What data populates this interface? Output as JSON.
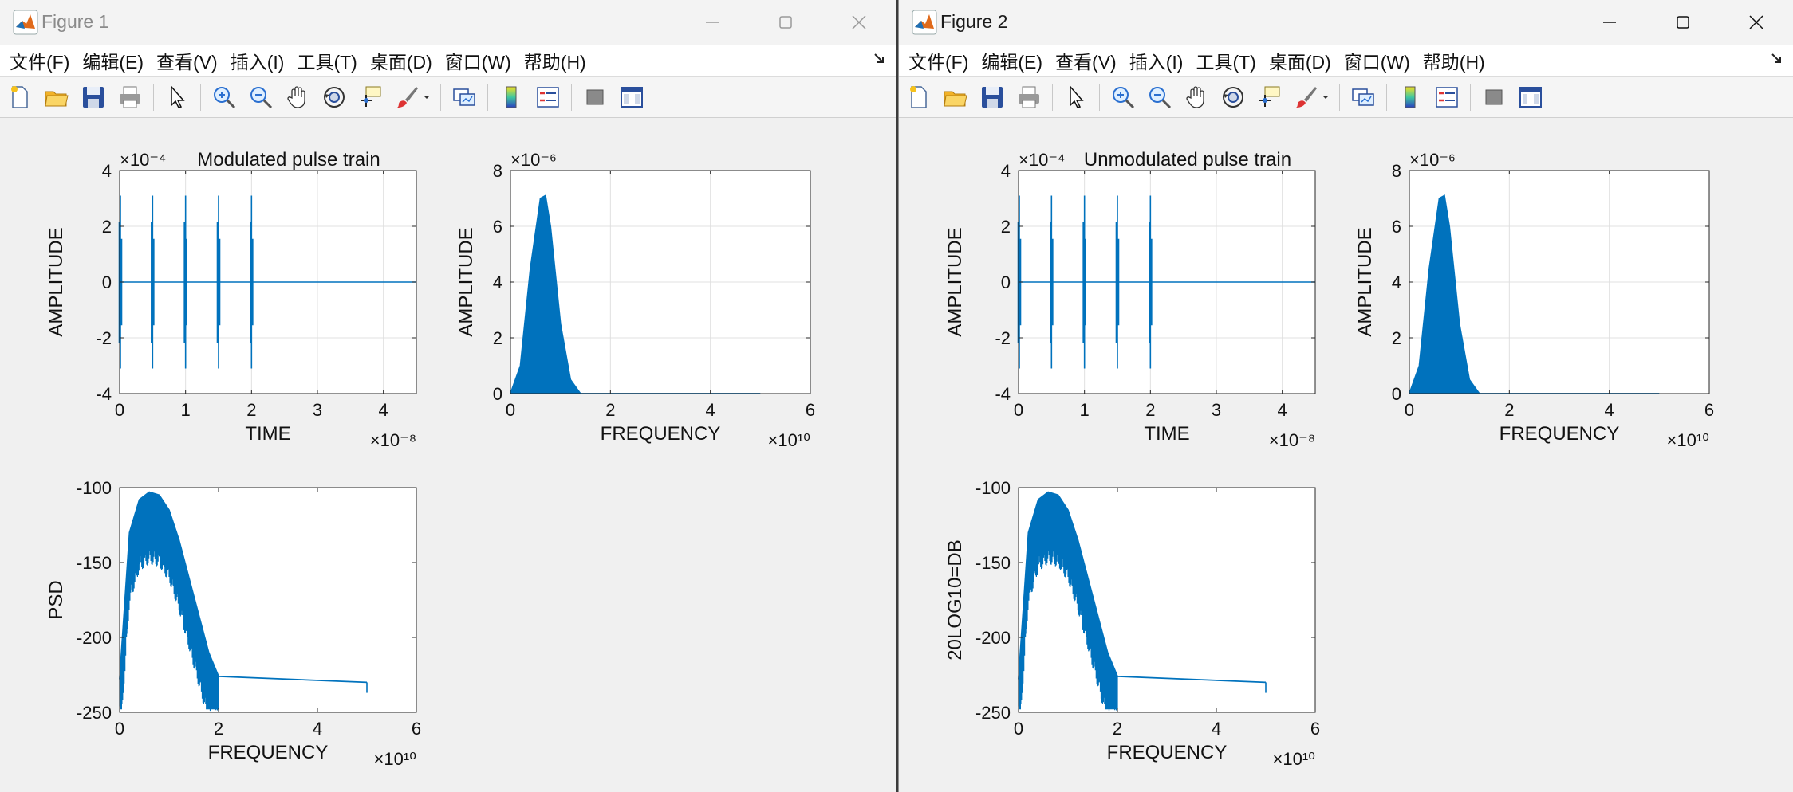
{
  "windows": [
    {
      "title": "Figure 1",
      "menus": [
        "文件(F)",
        "编辑(E)",
        "查看(V)",
        "插入(I)",
        "工具(T)",
        "桌面(D)",
        "窗口(W)",
        "帮助(H)"
      ],
      "plots": [
        {
          "title": "Modulated pulse train",
          "xlabel": "TIME",
          "ylabel": "AMPLITUDE",
          "xticks": [
            "0",
            "1",
            "2",
            "3",
            "4"
          ],
          "yticks": [
            "4",
            "2",
            "0",
            "-2",
            "-4"
          ],
          "yexp": "×10⁻⁴",
          "xexp": "×10⁻⁸"
        },
        {
          "title": "",
          "xlabel": "FREQUENCY",
          "ylabel": "AMPLITUDE",
          "xticks": [
            "0",
            "2",
            "4",
            "6"
          ],
          "yticks": [
            "8",
            "6",
            "4",
            "2",
            "0"
          ],
          "yexp": "×10⁻⁶",
          "xexp": "×10¹⁰"
        },
        {
          "title": "",
          "xlabel": "FREQUENCY",
          "ylabel": "PSD",
          "xticks": [
            "0",
            "2",
            "4",
            "6"
          ],
          "yticks": [
            "-100",
            "-150",
            "-200",
            "-250"
          ],
          "yexp": "",
          "xexp": "×10¹⁰"
        }
      ]
    },
    {
      "title": "Figure 2",
      "menus": [
        "文件(F)",
        "编辑(E)",
        "查看(V)",
        "插入(I)",
        "工具(T)",
        "桌面(D)",
        "窗口(W)",
        "帮助(H)"
      ],
      "plots": [
        {
          "title": "Unmodulated pulse train",
          "xlabel": "TIME",
          "ylabel": "AMPLITUDE",
          "xticks": [
            "0",
            "1",
            "2",
            "3",
            "4"
          ],
          "yticks": [
            "4",
            "2",
            "0",
            "-2",
            "-4"
          ],
          "yexp": "×10⁻⁴",
          "xexp": "×10⁻⁸"
        },
        {
          "title": "",
          "xlabel": "FREQUENCY",
          "ylabel": "AMPLITUDE",
          "xticks": [
            "0",
            "2",
            "4",
            "6"
          ],
          "yticks": [
            "8",
            "6",
            "4",
            "2",
            "0"
          ],
          "yexp": "×10⁻⁶",
          "xexp": "×10¹⁰"
        },
        {
          "title": "",
          "xlabel": "FREQUENCY",
          "ylabel": "20LOG10=DB",
          "xticks": [
            "0",
            "2",
            "4",
            "6"
          ],
          "yticks": [
            "-100",
            "-150",
            "-200",
            "-250"
          ],
          "yexp": "",
          "xexp": "×10¹⁰"
        }
      ]
    }
  ],
  "colors": {
    "line": "#0072bd",
    "grid": "#e0e0e0",
    "axes": "#262626",
    "figure_bg": "#f0f0f0"
  },
  "chart_data": [
    {
      "type": "line",
      "title": "Modulated pulse train",
      "xlabel": "TIME",
      "ylabel": "AMPLITUDE",
      "xlim": [
        0,
        4.5e-08
      ],
      "ylim": [
        -0.0004,
        0.0004
      ],
      "grid": true,
      "series": [
        {
          "pulse_times": [
            0,
            5e-09,
            1e-08,
            1.5e-08,
            2e-08
          ],
          "pulse_peak": 0.00031
        }
      ]
    },
    {
      "type": "line",
      "xlabel": "FREQUENCY",
      "ylabel": "AMPLITUDE",
      "xlim": [
        0,
        60000000000.0
      ],
      "ylim": [
        0,
        8e-06
      ],
      "grid": true,
      "series": [
        {
          "x": [
            0,
            2000000000.0,
            4000000000.0,
            6000000000.0,
            7000000000.0,
            8000000000.0,
            10000000000.0,
            12000000000.0,
            14000000000.0,
            50000000000.0
          ],
          "y": [
            0,
            1e-06,
            4.5e-06,
            7e-06,
            7.1e-06,
            6e-06,
            2.5e-06,
            5e-07,
            0,
            0
          ]
        }
      ]
    },
    {
      "type": "line",
      "xlabel": "FREQUENCY",
      "ylabel": "PSD",
      "xlim": [
        0,
        60000000000.0
      ],
      "ylim": [
        -250,
        -100
      ],
      "grid": false,
      "series": [
        {
          "x": [
            0,
            2000000000.0,
            4000000000.0,
            6000000000.0,
            8000000000.0,
            10000000000.0,
            12000000000.0,
            14000000000.0,
            16000000000.0,
            18000000000.0,
            20000000000.0,
            50000000000.0
          ],
          "y": [
            -228,
            -130,
            -108,
            -103,
            -105,
            -115,
            -135,
            -160,
            -185,
            -210,
            -226,
            -230
          ]
        }
      ]
    },
    {
      "type": "line",
      "title": "Unmodulated pulse train",
      "xlabel": "TIME",
      "ylabel": "AMPLITUDE",
      "xlim": [
        0,
        4.5e-08
      ],
      "ylim": [
        -0.0004,
        0.0004
      ],
      "grid": true,
      "series": [
        {
          "pulse_times": [
            0,
            5e-09,
            1e-08,
            1.5e-08,
            2e-08
          ],
          "pulse_peak": 0.00031
        }
      ]
    },
    {
      "type": "line",
      "xlabel": "FREQUENCY",
      "ylabel": "AMPLITUDE",
      "xlim": [
        0,
        60000000000.0
      ],
      "ylim": [
        0,
        8e-06
      ],
      "grid": true,
      "series": [
        {
          "x": [
            0,
            2000000000.0,
            4000000000.0,
            6000000000.0,
            7000000000.0,
            8000000000.0,
            10000000000.0,
            12000000000.0,
            14000000000.0,
            50000000000.0
          ],
          "y": [
            0,
            1e-06,
            4.5e-06,
            7e-06,
            7.1e-06,
            6e-06,
            2.5e-06,
            5e-07,
            0,
            0
          ]
        }
      ]
    },
    {
      "type": "line",
      "xlabel": "FREQUENCY",
      "ylabel": "20LOG10=DB",
      "xlim": [
        0,
        60000000000.0
      ],
      "ylim": [
        -250,
        -100
      ],
      "grid": false,
      "series": [
        {
          "x": [
            0,
            2000000000.0,
            4000000000.0,
            6000000000.0,
            8000000000.0,
            10000000000.0,
            12000000000.0,
            14000000000.0,
            16000000000.0,
            18000000000.0,
            20000000000.0,
            50000000000.0
          ],
          "y": [
            -228,
            -130,
            -108,
            -103,
            -105,
            -115,
            -135,
            -160,
            -185,
            -210,
            -226,
            -230
          ]
        }
      ]
    }
  ]
}
